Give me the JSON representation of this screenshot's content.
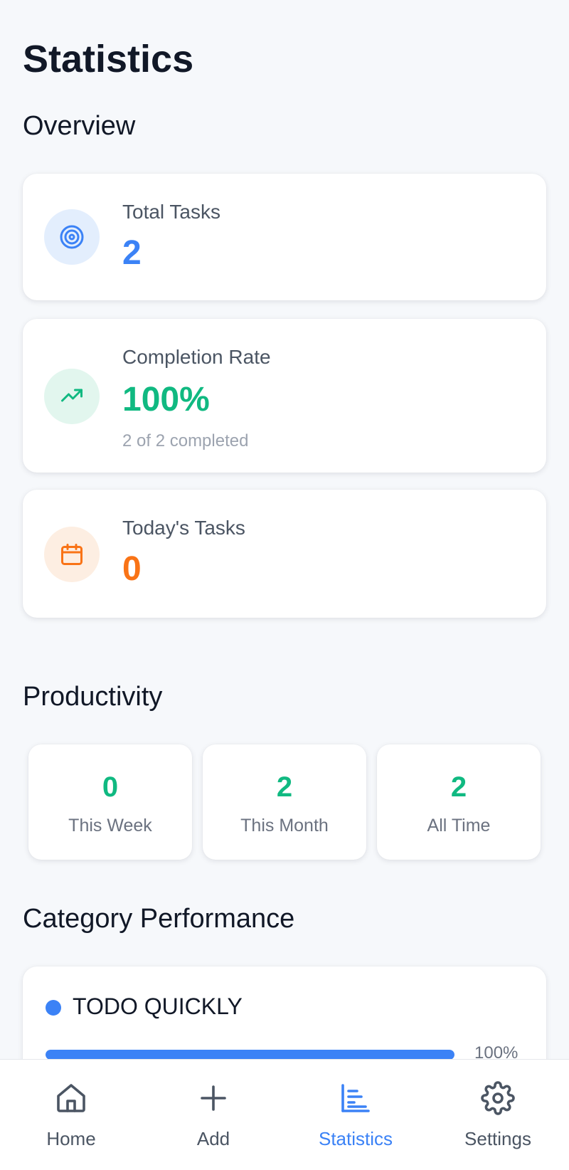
{
  "status_bar": {
    "left": "",
    "right": ""
  },
  "title": "Statistics",
  "overview": {
    "heading": "Overview",
    "total_tasks": {
      "label": "Total Tasks",
      "value": "2",
      "icon": "target-icon",
      "color": "#3b82f6"
    },
    "completion_rate": {
      "label": "Completion Rate",
      "value": "100%",
      "subtext": "2 of 2 completed",
      "icon": "trending-up-icon",
      "color": "#10b981"
    },
    "todays_tasks": {
      "label": "Today's Tasks",
      "value": "0",
      "icon": "calendar-icon",
      "color": "#f97316"
    }
  },
  "productivity": {
    "heading": "Productivity",
    "items": [
      {
        "value": "0",
        "label": "This Week"
      },
      {
        "value": "2",
        "label": "This Month"
      },
      {
        "value": "2",
        "label": "All Time"
      }
    ]
  },
  "category_performance": {
    "heading": "Category Performance",
    "categories": [
      {
        "name": "TODO QUICKLY",
        "percent_label": "100%",
        "progress": 1.0,
        "color": "#3b82f6"
      }
    ]
  },
  "bottom_nav": {
    "items": [
      {
        "label": "Home",
        "icon": "home-icon",
        "active": false
      },
      {
        "label": "Add",
        "icon": "plus-icon",
        "active": false
      },
      {
        "label": "Statistics",
        "icon": "bar-chart-icon",
        "active": true
      },
      {
        "label": "Settings",
        "icon": "gear-icon",
        "active": false
      }
    ]
  }
}
